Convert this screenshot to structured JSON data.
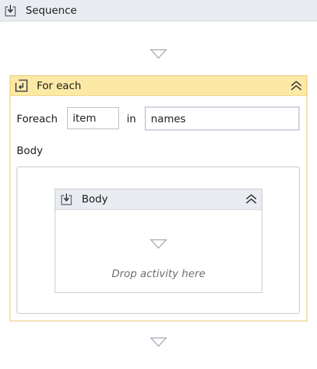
{
  "sequence": {
    "title": "Sequence",
    "icon": "sequence-icon"
  },
  "foreach": {
    "title": "For each",
    "icon": "foreach-icon",
    "foreach_label": "Foreach",
    "item_value": "item",
    "in_label": "in",
    "collection_value": "names",
    "body_label": "Body"
  },
  "body_sequence": {
    "title": "Body",
    "icon": "sequence-icon",
    "drop_hint": "Drop activity here"
  },
  "colors": {
    "sequence_header": "#e9ecf0",
    "foreach_header": "#fde9a6",
    "foreach_border": "#e6c66a",
    "drop_arrow": "#a9afb8"
  }
}
